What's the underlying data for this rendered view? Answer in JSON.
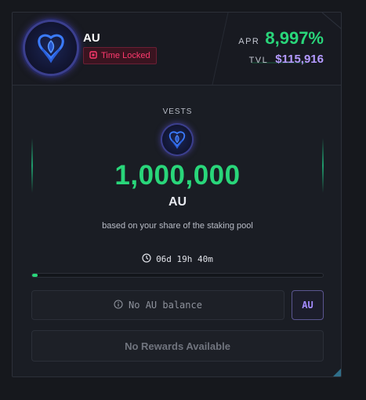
{
  "token": {
    "name": "AU",
    "lock_badge": "Time Locked"
  },
  "stats": {
    "apr_label": "APR",
    "apr_value": "8,997%",
    "tvl_label": "TVL",
    "tvl_value": "$115,916"
  },
  "vests": {
    "label": "VESTS",
    "amount": "1,000,000",
    "unit": "AU",
    "note": "based on your share of the staking pool"
  },
  "timer": {
    "remaining": "06d 19h 40m",
    "progress_fraction": 0.02
  },
  "balance": {
    "text": "No AU balance",
    "token_button": "AU"
  },
  "rewards": {
    "text": "No Rewards Available"
  },
  "colors": {
    "accent_green": "#29d67a",
    "accent_purple": "#b49aff",
    "lock_red": "#ff3a6e"
  },
  "icons": {
    "token": "au-token-icon",
    "lock": "lock-icon",
    "clock": "clock-icon",
    "info": "info-icon"
  }
}
